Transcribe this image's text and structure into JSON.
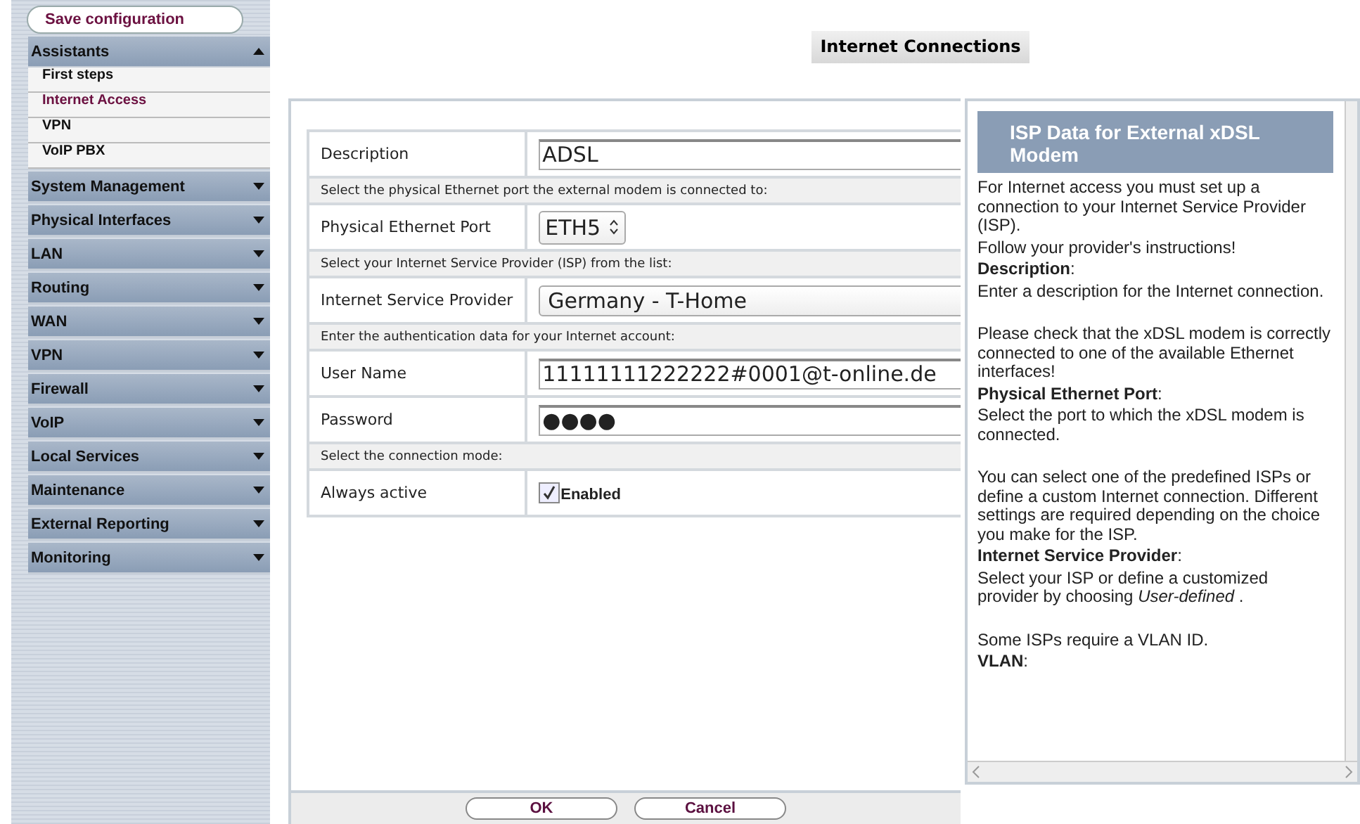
{
  "sidebar": {
    "save_button": "Save configuration",
    "sections": [
      {
        "label": "Assistants",
        "expanded": true,
        "children": [
          {
            "label": "First steps",
            "selected": false
          },
          {
            "label": "Internet Access",
            "selected": true
          },
          {
            "label": "VPN",
            "selected": false
          },
          {
            "label": "VoIP PBX",
            "selected": false
          }
        ]
      },
      {
        "label": "System Management",
        "expanded": false
      },
      {
        "label": "Physical Interfaces",
        "expanded": false
      },
      {
        "label": "LAN",
        "expanded": false
      },
      {
        "label": "Routing",
        "expanded": false
      },
      {
        "label": "WAN",
        "expanded": false
      },
      {
        "label": "VPN",
        "expanded": false
      },
      {
        "label": "Firewall",
        "expanded": false
      },
      {
        "label": "VoIP",
        "expanded": false
      },
      {
        "label": "Local Services",
        "expanded": false
      },
      {
        "label": "Maintenance",
        "expanded": false
      },
      {
        "label": "External Reporting",
        "expanded": false
      },
      {
        "label": "Monitoring",
        "expanded": false
      }
    ]
  },
  "page_title": "Internet Connections",
  "form": {
    "rows": [
      {
        "kind": "text",
        "label": "Description",
        "value": "ADSL"
      },
      {
        "kind": "section",
        "text": "Select the physical Ethernet port the external modem is connected to:"
      },
      {
        "kind": "spinner",
        "label": "Physical Ethernet Port",
        "value": "ETH5"
      },
      {
        "kind": "section",
        "text": "Select your Internet Service Provider (ISP) from the list:"
      },
      {
        "kind": "select",
        "label": "Internet Service Provider",
        "value": "Germany - T-Home"
      },
      {
        "kind": "section",
        "text": "Enter the authentication data for your Internet account:"
      },
      {
        "kind": "text",
        "label": "User Name",
        "value": "11111111222222#0001@t-online.de"
      },
      {
        "kind": "password",
        "label": "Password",
        "value": "●●●●"
      },
      {
        "kind": "section",
        "text": "Select the connection mode:"
      },
      {
        "kind": "checkbox",
        "label": "Always active",
        "text": "Enabled",
        "checked": true
      }
    ],
    "buttons": [
      "OK",
      "Cancel"
    ]
  },
  "help": {
    "title": "ISP Data for External xDSL Modem",
    "sections": [
      {
        "paragraphs": [
          "For Internet access you must set up a connection to your Internet Service Provider (ISP).",
          "Follow your provider's instructions!",
          "**Description**:",
          "Enter a description for the Internet connection."
        ]
      },
      {
        "paragraphs": [
          "Please check that the xDSL modem is correctly connected to one of the available Ethernet interfaces!",
          "**Physical Ethernet Port**:",
          "Select the port to which the xDSL modem is connected."
        ]
      },
      {
        "paragraphs": [
          "You can select one of the predefined ISPs or define a custom Internet connection. Different settings are required depending on the choice you make for the ISP.",
          "**Internet Service Provider**:",
          "Select your ISP or define a customized provider by choosing *User-defined* ."
        ]
      },
      {
        "paragraphs": [
          "Some ISPs require a VLAN ID.",
          "**VLAN**:"
        ]
      }
    ]
  }
}
